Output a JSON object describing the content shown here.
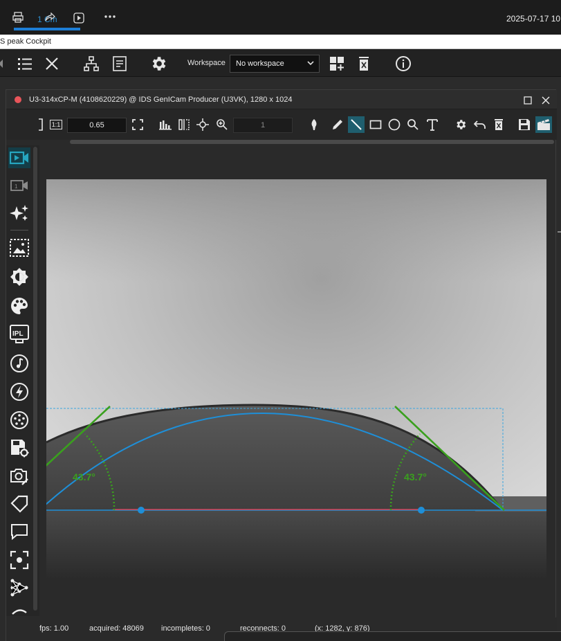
{
  "os_bar": {
    "tab_text": "1 Cm",
    "clock": "2025-07-17 10"
  },
  "app": {
    "title": "S peak Cockpit"
  },
  "main_toolbar": {
    "workspace_label": "Workspace",
    "workspace_value": "No workspace"
  },
  "viewer": {
    "title": "U3-314xCP-M (4108620229) @ IDS GenICam Producer (U3VK), 1280 x 1024",
    "zoom_value": "0.65",
    "page_value": "1",
    "one_to_one_label": "1:1"
  },
  "measurement": {
    "left_angle": "43.7°",
    "right_angle": "43.7°",
    "colors": {
      "tangent": "#3aa01e",
      "arc": "#1e8fd8",
      "baseline": "#1e8fd8",
      "contact": "#d84050"
    }
  },
  "status": {
    "fps": "fps: 1.00",
    "acquired": "acquired: 48069",
    "incompletes": "incompletes: 0",
    "reconnects": "reconnects: 0",
    "coords": "(x: 1282, y: 876)"
  },
  "icons": {
    "main_toolbar": [
      "list-icon",
      "close-icon",
      "network-icon",
      "document-icon",
      "gear-icon",
      "add-grid-icon",
      "trash-icon",
      "info-icon"
    ],
    "sidebar": [
      "camera-active-icon",
      "camera-icon",
      "sparkle-icon",
      "roi-icon",
      "brightness-icon",
      "palette-icon",
      "ipl-icon",
      "music-note-icon",
      "lightning-icon",
      "dots-circle-icon",
      "save-settings-icon",
      "camera-settings-icon",
      "tag-icon",
      "comment-icon",
      "focus-icon",
      "network-graph-icon",
      "wave-icon"
    ]
  }
}
